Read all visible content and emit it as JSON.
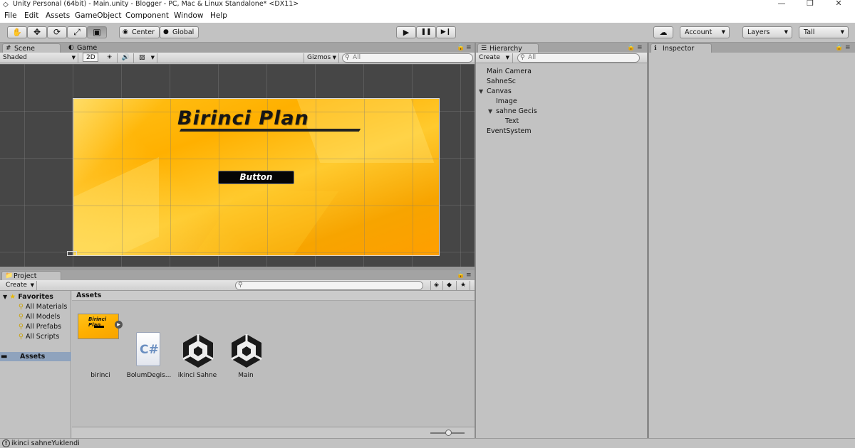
{
  "window": {
    "title": "Unity Personal (64bit) - Main.unity - Blogger - PC, Mac & Linux Standalone* <DX11>",
    "minimize_glyph": "—",
    "restore_glyph": "❐",
    "close_glyph": "✕"
  },
  "menu": [
    "File",
    "Edit",
    "Assets",
    "GameObject",
    "Component",
    "Window",
    "Help"
  ],
  "toolbar": {
    "tools": [
      "hand-tool",
      "move-tool",
      "rotate-tool",
      "scale-tool",
      "rect-tool"
    ],
    "tool_glyphs": [
      "✋",
      "✥",
      "⟳",
      "⤢",
      "▣"
    ],
    "pivot_label": "Center",
    "space_label": "Global",
    "play_glyph": "▶",
    "pause_glyph": "❚❚",
    "step_glyph": "▶❙",
    "cloud_glyph": "☁",
    "account_label": "Account",
    "layers_label": "Layers",
    "layout_label": "Tall"
  },
  "scene_panel": {
    "tabs": [
      {
        "label": "Scene",
        "icon": "#"
      },
      {
        "label": "Game",
        "icon": "◐"
      }
    ],
    "shading_mode": "Shaded",
    "mode_2d": "2D",
    "light_glyph": "☀",
    "audio_glyph": "🔊",
    "effects_glyph": "▨",
    "gizmos_label": "Gizmos",
    "search_placeholder": "All",
    "canvas_title": "Birinci Plan",
    "canvas_button": "Button"
  },
  "hierarchy": {
    "tab": "Hierarchy",
    "tab_icon": "☰",
    "create_label": "Create",
    "search_placeholder": "All",
    "items": [
      {
        "label": "Main Camera",
        "depth": 0,
        "expanded": null
      },
      {
        "label": "SahneSc",
        "depth": 0,
        "expanded": null
      },
      {
        "label": "Canvas",
        "depth": 0,
        "expanded": true
      },
      {
        "label": "Image",
        "depth": 1,
        "expanded": null
      },
      {
        "label": "sahne Gecis",
        "depth": 1,
        "expanded": true
      },
      {
        "label": "Text",
        "depth": 2,
        "expanded": null
      },
      {
        "label": "EventSystem",
        "depth": 0,
        "expanded": null
      }
    ]
  },
  "inspector": {
    "tab": "Inspector",
    "tab_icon": "ℹ"
  },
  "project": {
    "tab": "Project",
    "tab_icon": "📁",
    "create_label": "Create",
    "favorites_label": "Favorites",
    "favorites": [
      "All Materials",
      "All Models",
      "All Prefabs",
      "All Scripts"
    ],
    "assets_folder": "Assets",
    "assets_header": "Assets",
    "assets": [
      {
        "label": "birinci",
        "kind": "image"
      },
      {
        "label": "BolumDegis...",
        "kind": "script"
      },
      {
        "label": "ikinci Sahne",
        "kind": "scene"
      },
      {
        "label": "Main",
        "kind": "scene"
      }
    ],
    "cs_glyph": "C#",
    "thumb_title": "Birinci Plan",
    "zoom_level": 0.55
  },
  "status": {
    "icon_glyph": "!",
    "message": "ikinci sahneYuklendi"
  },
  "colors": {
    "accent_selection": "#8fa3bd",
    "panel_bg": "#c2c2c2",
    "scene_bg": "#464646",
    "canvas_orange": "#ffb000"
  }
}
